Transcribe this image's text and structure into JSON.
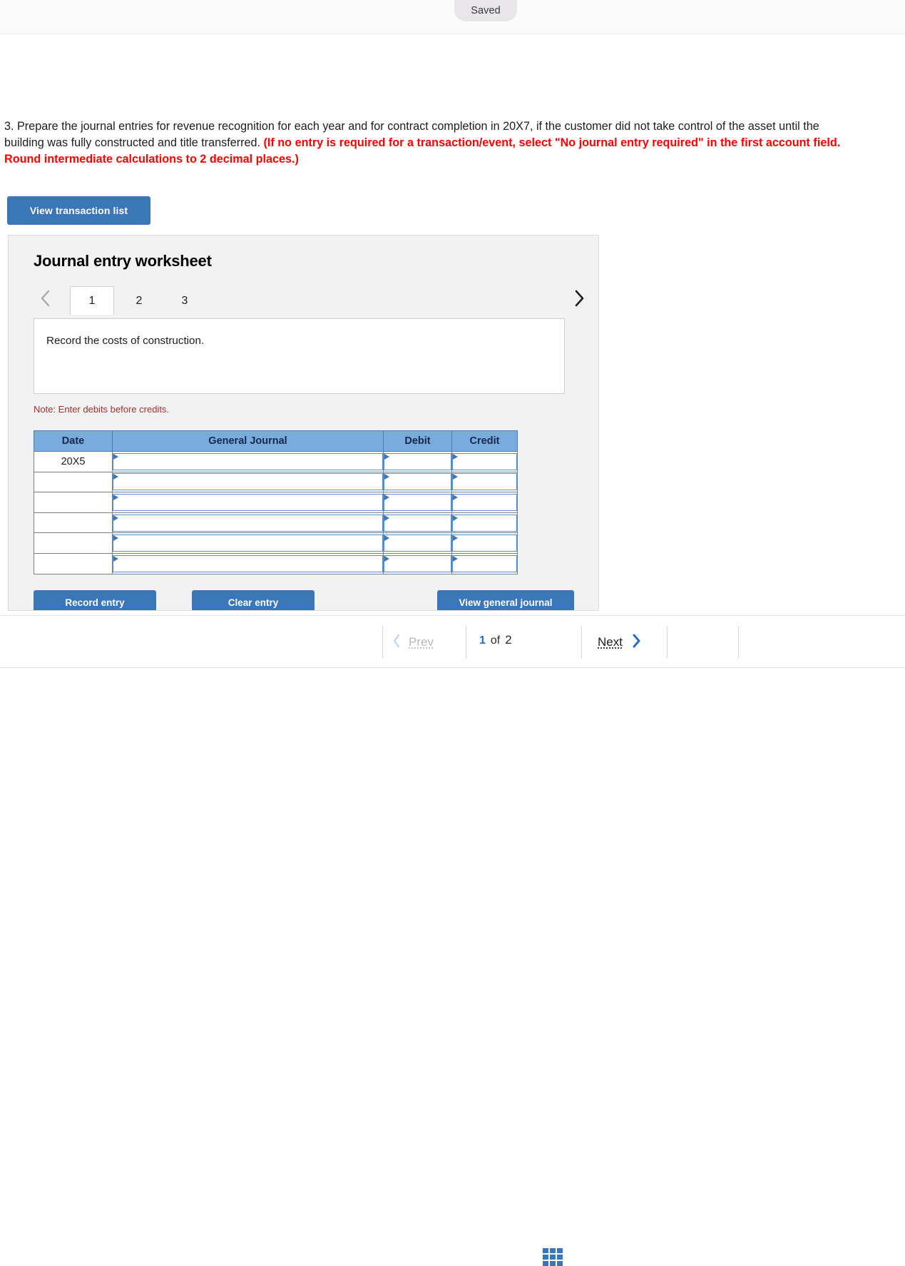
{
  "top_bar": {
    "saved_label": "Saved"
  },
  "question": {
    "plain": "3. Prepare the journal entries for revenue recognition for each year and for contract completion in 20X7, if the customer did not take control of the asset until the building was fully constructed and title transferred. ",
    "emphasis": "(If no entry is required for a transaction/event, select \"No journal entry required\" in the first account field. Round intermediate calculations to 2 decimal places.)",
    "emphasis_color": "#ff0000"
  },
  "buttons": {
    "view_transaction_list": "View transaction list",
    "record_entry": "Record entry",
    "clear_entry": "Clear entry",
    "view_general_journal": "View general journal"
  },
  "worksheet": {
    "title": "Journal entry worksheet",
    "tabs": [
      {
        "label": "1",
        "active": true
      },
      {
        "label": "2",
        "active": false
      },
      {
        "label": "3",
        "active": false
      }
    ],
    "prev_arrow_icon": "chevron-left-icon",
    "next_arrow_icon": "chevron-right-icon",
    "prev_arrow_enabled": false,
    "next_arrow_enabled": true,
    "instruction": "Record the costs of construction.",
    "note": "Note: Enter debits before credits.",
    "accent_color": "#3a76b8",
    "table": {
      "headers": [
        "Date",
        "General Journal",
        "Debit",
        "Credit"
      ],
      "rows": [
        {
          "date": "20X5",
          "general_journal": "",
          "debit": "",
          "credit": ""
        },
        {
          "date": "",
          "general_journal": "",
          "debit": "",
          "credit": ""
        },
        {
          "date": "",
          "general_journal": "",
          "debit": "",
          "credit": ""
        },
        {
          "date": "",
          "general_journal": "",
          "debit": "",
          "credit": ""
        },
        {
          "date": "",
          "general_journal": "",
          "debit": "",
          "credit": ""
        },
        {
          "date": "",
          "general_journal": "",
          "debit": "",
          "credit": ""
        }
      ]
    }
  },
  "bottom_nav": {
    "prev_label": "Prev",
    "next_label": "Next",
    "page_current": "1",
    "page_of": "of",
    "page_total": "2",
    "grid_icon": "grid-icon",
    "prev_icon": "chevron-left-icon",
    "next_icon": "chevron-right-icon",
    "prev_enabled": false,
    "next_enabled": true
  }
}
